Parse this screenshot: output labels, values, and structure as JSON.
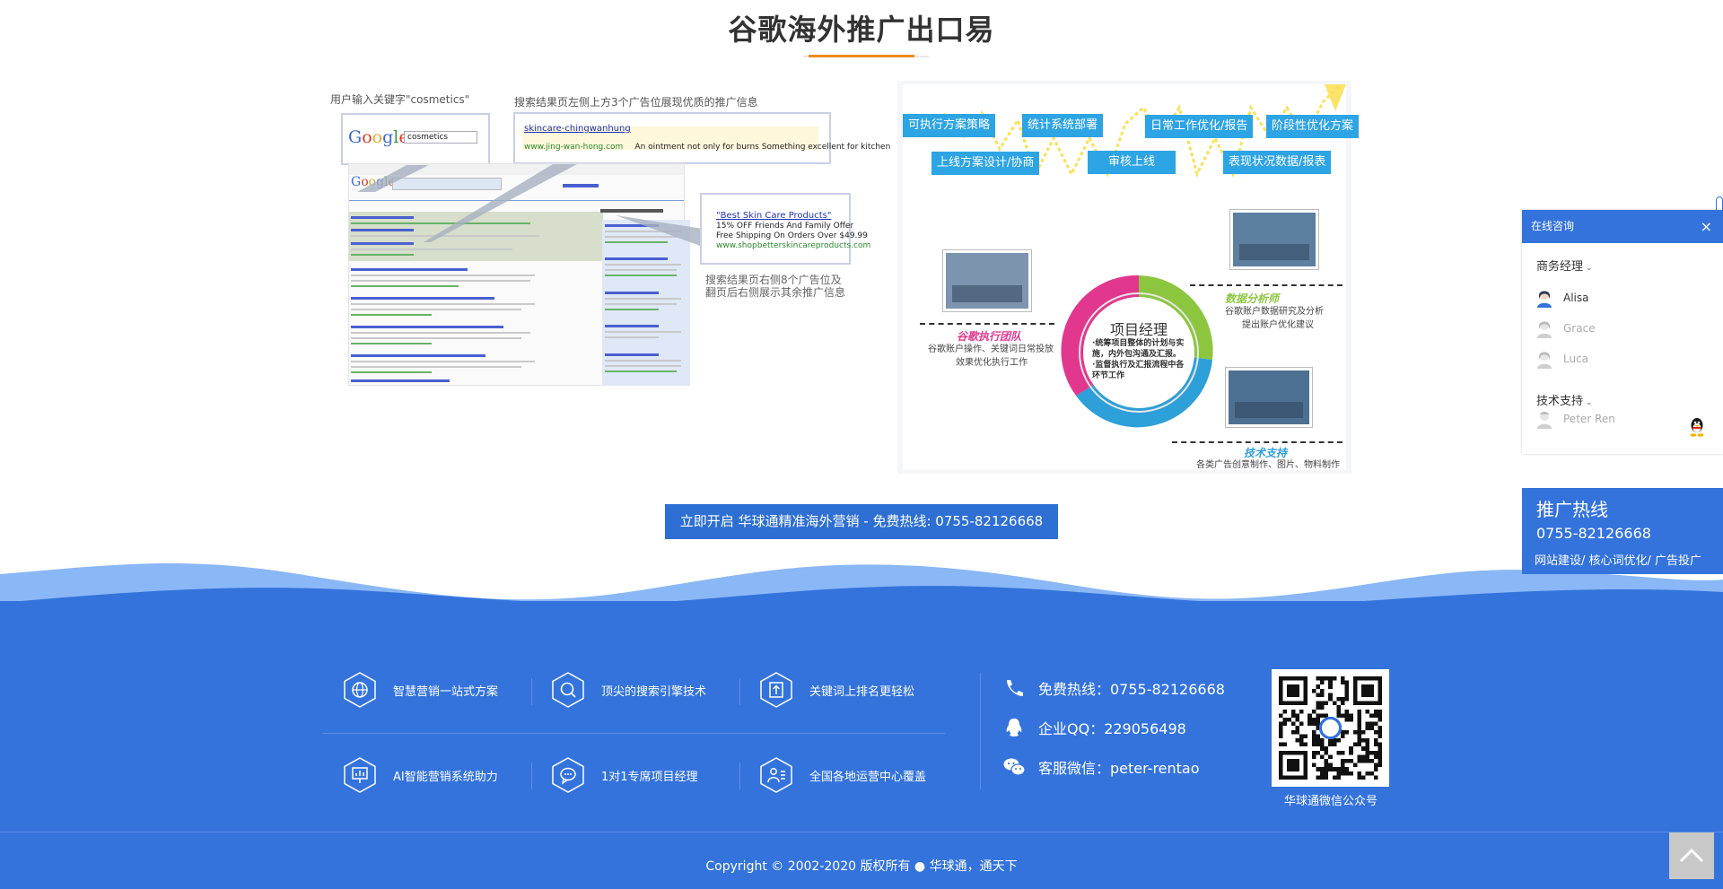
{
  "section": {
    "title": "谷歌海外推广出口易"
  },
  "serp": {
    "caption_keyword": "用户输入关键字\"cosmetics\"",
    "caption_top_ads": "搜索结果页左侧上方3个广告位展现优质的推广信息",
    "caption_side_ads_1": "搜索结果页右侧8个广告位及",
    "caption_side_ads_2": "翻页后右侧展示其余推广信息",
    "search_query": "cosmetics",
    "google_logo": "Google",
    "top_ad_title": "skincare-chingwanhung",
    "top_ad_url": "www.jing-wan-hong.com",
    "top_ad_text": "An ointment not only for burns Something excellent for kitchen",
    "side_ad_title": "\"Best Skin Care Products\"",
    "side_ad_line1": "15% OFF Friends And Family Offer",
    "side_ad_line2": "Free Shipping On Orders Over $49.99",
    "side_ad_url": "www.shopbetterskincareproducts.com"
  },
  "diagram": {
    "tags": [
      "可执行方案策略",
      "统计系统部署",
      "日常工作优化/报告",
      "阶段性优化方案",
      "上线方案设计/协商",
      "审核上线",
      "表现状况数据/报表"
    ],
    "center_title": "项目经理",
    "center_desc_1": "·统筹项目整体的计划与实",
    "center_desc_2": "施，内外包沟通及汇报。",
    "center_desc_3": "·监督执行及汇报流程中各",
    "center_desc_4": "环节工作",
    "team_role": "谷歌执行团队",
    "team_desc_1": "谷歌账户操作、关键词日常投放",
    "team_desc_2": "效果优化执行工作",
    "analyst_role": "数据分析师",
    "analyst_desc_1": "谷歌账户数据研究及分析",
    "analyst_desc_2": "提出账户优化建议",
    "tech_role": "技术支持",
    "tech_desc": "各类广告创意制作、图片、物料制作",
    "colors": {
      "tag": "#2da4e4",
      "pink": "#e2378e",
      "green": "#8cc63f",
      "blue": "#2d9fd9"
    }
  },
  "cta": {
    "label": "立即开启 华球通精准海外营销 - 免费热线: 0755-82126668"
  },
  "footer": {
    "features": [
      {
        "label": "智慧营销一站式方案",
        "icon": "globe-icon"
      },
      {
        "label": "顶尖的搜索引擎技术",
        "icon": "search-icon"
      },
      {
        "label": "关键词上排名更轻松",
        "icon": "rank-up-icon"
      },
      {
        "label": "AI智能营销系统助力",
        "icon": "presentation-icon"
      },
      {
        "label": "1对1专席项目经理",
        "icon": "chat-icon"
      },
      {
        "label": "全国各地运营中心覆盖",
        "icon": "contacts-icon"
      }
    ],
    "contacts": [
      {
        "label": "免费热线：0755-82126668",
        "icon": "phone-icon"
      },
      {
        "label": "企业QQ：229056498",
        "icon": "qq-icon"
      },
      {
        "label": "客服微信：peter-rentao",
        "icon": "wechat-icon"
      }
    ],
    "qr_caption": "华球通微信公众号",
    "copyright": "Copyright © 2002-2020 版权所有 ● 华球通，通天下",
    "colors": {
      "background": "#3473dc",
      "wave_light": "#8ab7f5"
    }
  },
  "consult": {
    "title": "在线咨询",
    "close": "×",
    "group_business": "商务经理",
    "group_tech": "技术支持",
    "agents": [
      {
        "name": "Alisa",
        "online": true
      },
      {
        "name": "Grace",
        "online": false
      },
      {
        "name": "Luca",
        "online": false
      }
    ],
    "tech_agent": "Peter Ren"
  },
  "hotline": {
    "title": "推广热线",
    "phone": "0755-82126668",
    "services": "网站建设/ 核心词优化/ 广告投广"
  }
}
